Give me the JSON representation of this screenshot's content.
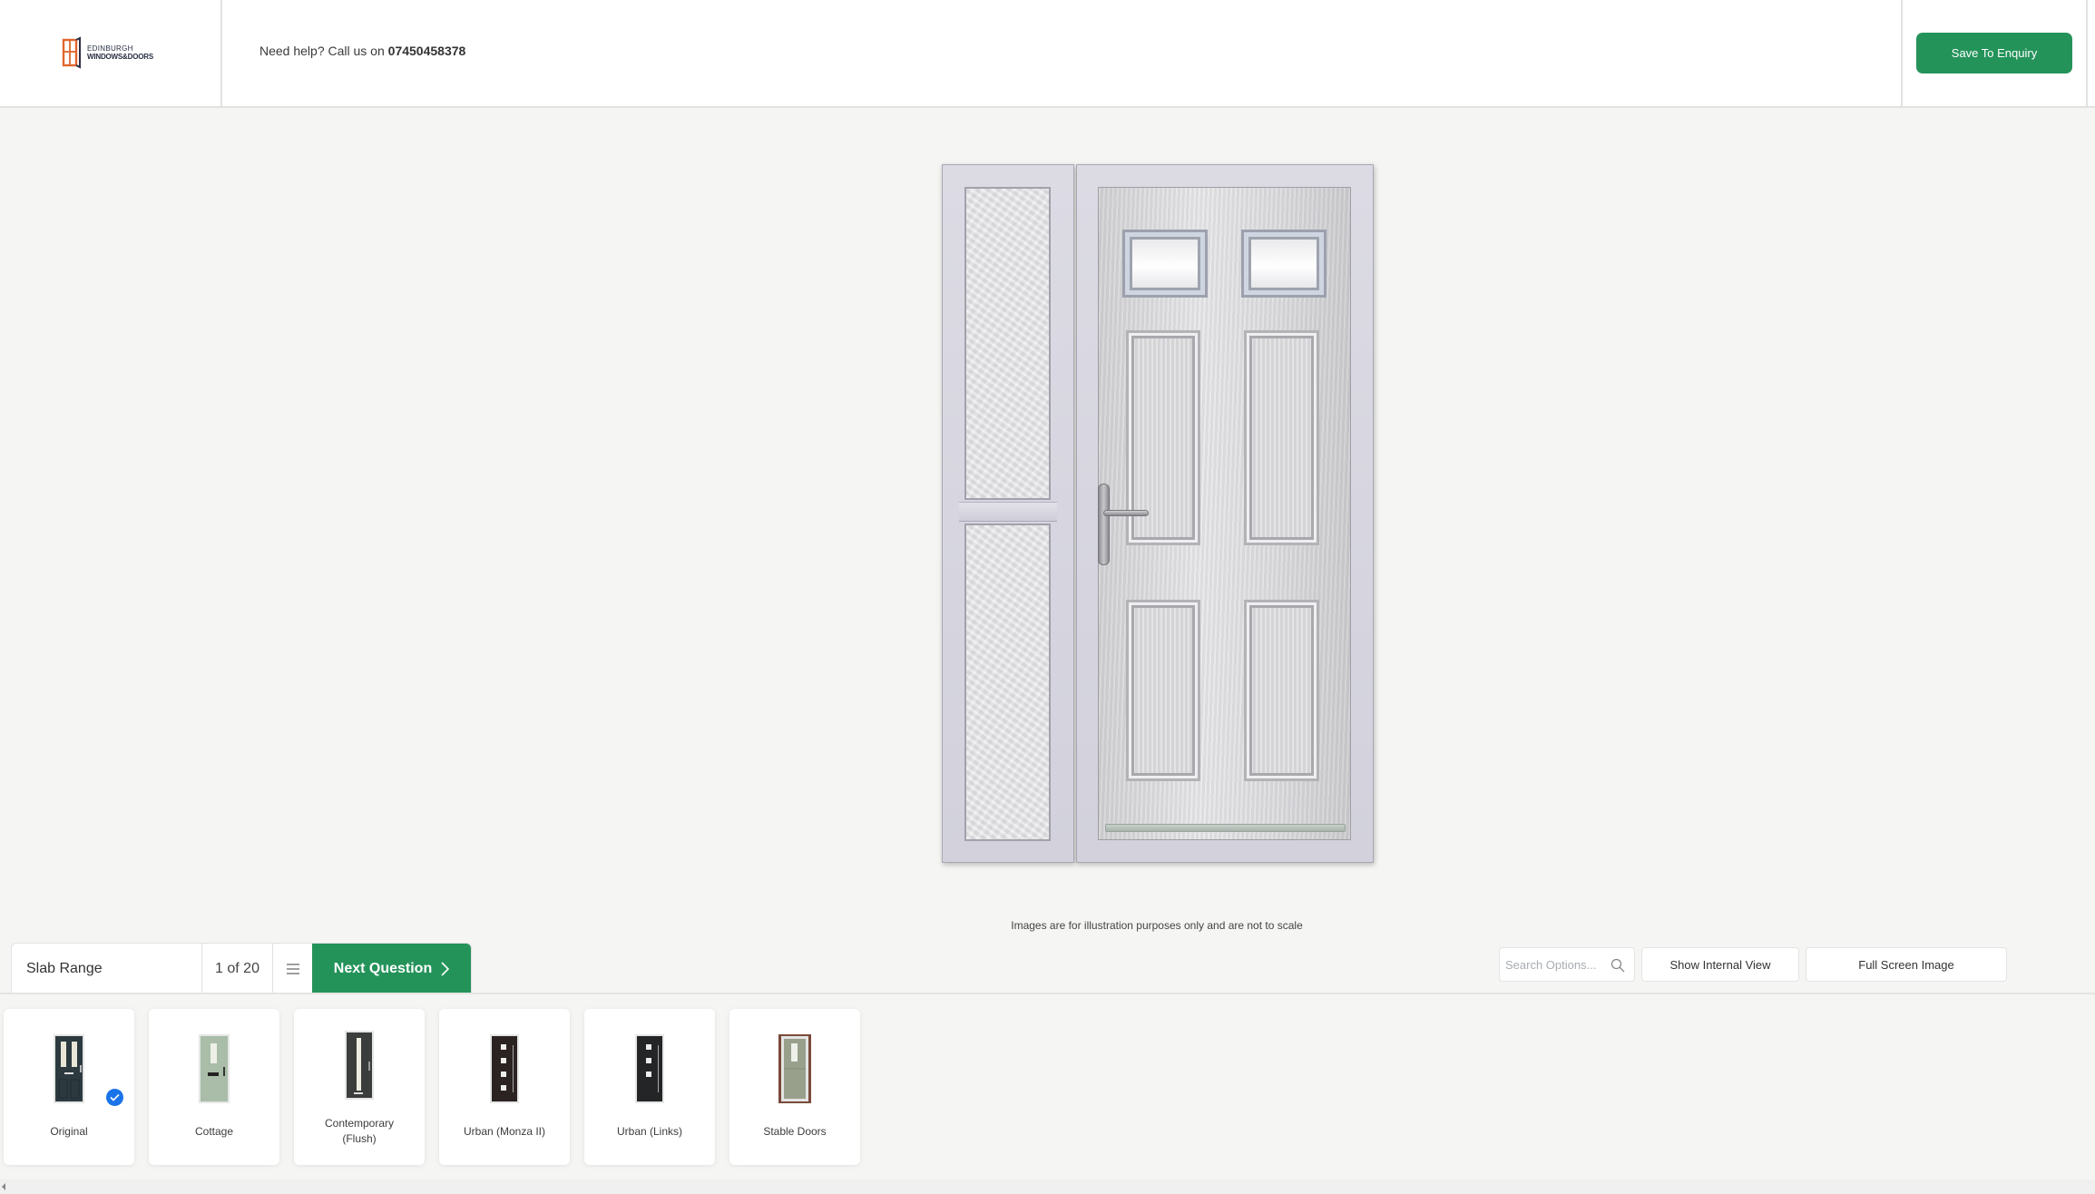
{
  "header": {
    "logo": {
      "line1": "EDINBURGH",
      "line2": "WINDOWS&DOORS",
      "icon": "window-frame-logo-icon"
    },
    "help_text": "Need help? Call us on ",
    "phone": "07450458378",
    "save_button": "Save To Enquiry"
  },
  "preview": {
    "disclaimer": "Images are for illustration purposes only and are not to scale"
  },
  "question_bar": {
    "title": "Slab Range",
    "progress": "1 of 20",
    "list_icon": "list-menu-icon",
    "next_button": "Next Question",
    "next_icon": "chevron-right-icon"
  },
  "tools": {
    "search_placeholder": "Search Options...",
    "search_value": "",
    "search_icon": "search-icon",
    "internal_view_button": "Show Internal View",
    "full_screen_button": "Full Screen Image"
  },
  "options": [
    {
      "label": "Original",
      "selected": true
    },
    {
      "label": "Cottage",
      "selected": false
    },
    {
      "label": "Contemporary (Flush)",
      "selected": false
    },
    {
      "label": "Urban (Monza II)",
      "selected": false
    },
    {
      "label": "Urban (Links)",
      "selected": false
    },
    {
      "label": "Stable Doors",
      "selected": false
    }
  ],
  "colors": {
    "brand_green": "#24935a",
    "selected_blue": "#1a73e8",
    "logo_orange": "#e0662f",
    "logo_navy": "#2a2f45"
  }
}
